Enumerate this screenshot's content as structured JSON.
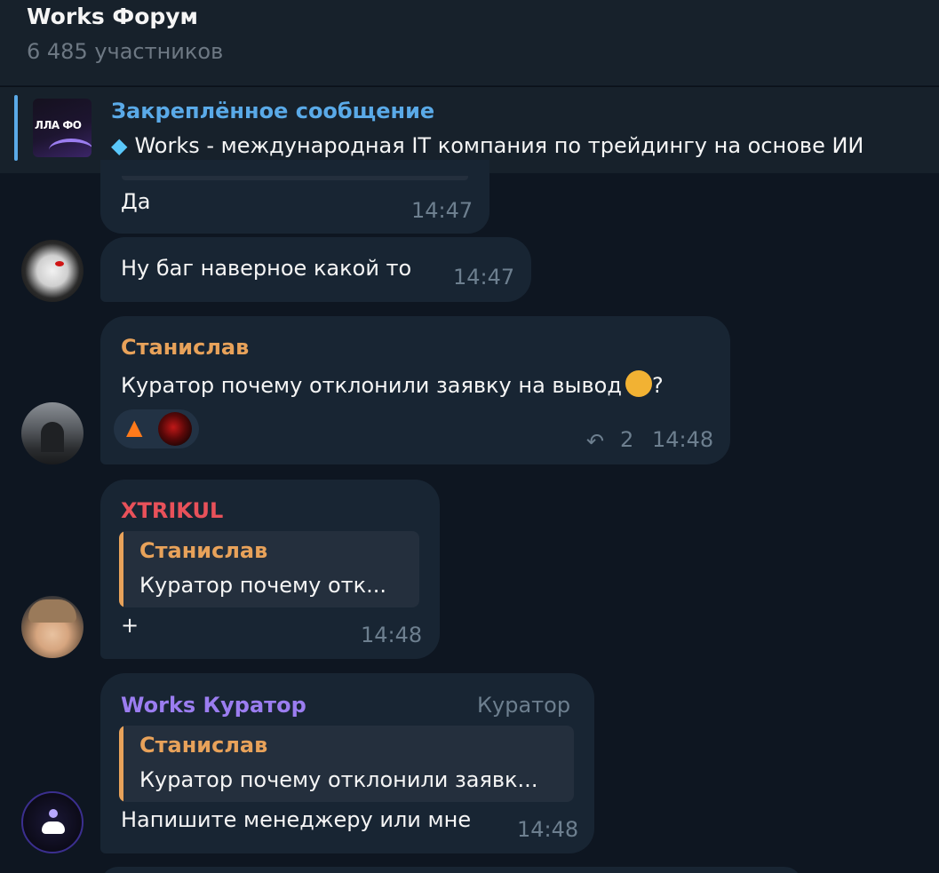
{
  "header": {
    "title": "Works Форум",
    "subtitle": "6 485 участников"
  },
  "pinned": {
    "title": "Закреплённое сообщение",
    "text": "Works - международная IT компания по трейдингу на основе ИИ",
    "thumb_text": "ЛЛА ФО",
    "gem_icon": "gem-icon"
  },
  "messages": [
    {
      "text": "Да",
      "time": "14:47"
    },
    {
      "text": "Ну баг наверное какой то",
      "time": "14:47"
    },
    {
      "sender": "Станислав",
      "sender_color": "#e8a25a",
      "text_before": "Куратор почему отклонили заявку на вывод",
      "text_after": "?",
      "reactions": [
        "fire-icon",
        "user-avatar"
      ],
      "reply_count": "2",
      "time": "14:48"
    },
    {
      "sender": "XTRIKUL",
      "sender_color": "#e8515a",
      "quote": {
        "name": "Станислав",
        "text": "Куратор почему отк..."
      },
      "text": "+",
      "time": "14:48"
    },
    {
      "sender": "Works Куратор",
      "sender_color": "#9b7df0",
      "role": "Куратор",
      "quote": {
        "name": "Станислав",
        "text": "Куратор почему отклонили заявк..."
      },
      "text": "Напишите менеджеру или мне",
      "time": "14:48"
    }
  ]
}
